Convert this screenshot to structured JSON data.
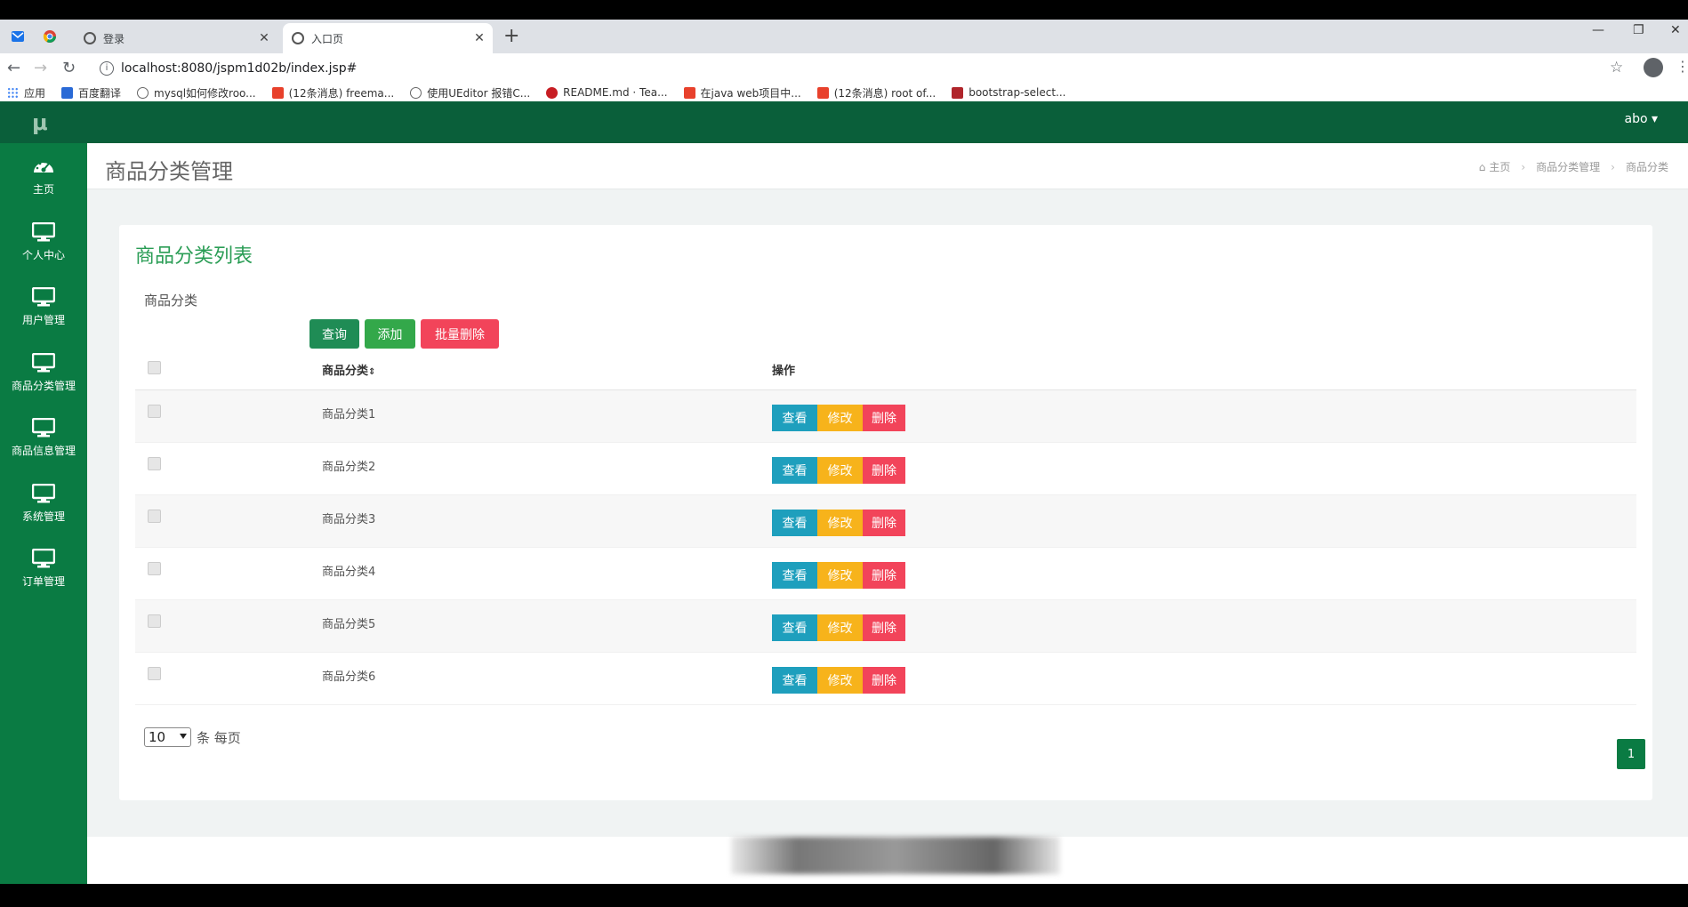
{
  "browser": {
    "tabs": [
      {
        "title": "登录"
      },
      {
        "title": "入口页"
      }
    ],
    "url": "localhost:8080/jspm1d02b/index.jsp#",
    "bookmarks": [
      {
        "label": "应用",
        "color": "#4285f4"
      },
      {
        "label": "百度翻译",
        "color": "#2a6ad6"
      },
      {
        "label": "mysql如何修改roo...",
        "color": "#666666"
      },
      {
        "label": "(12条消息) freema...",
        "color": "#e8412c"
      },
      {
        "label": "使用UEditor 报错C...",
        "color": "#666666"
      },
      {
        "label": "README.md · Tea...",
        "color": "#c71d23"
      },
      {
        "label": "在java web项目中...",
        "color": "#e8412c"
      },
      {
        "label": "(12条消息) root of...",
        "color": "#e8412c"
      },
      {
        "label": "bootstrap-select...",
        "color": "#b0252b"
      }
    ]
  },
  "app": {
    "logo": "μ",
    "user": "abo ▾",
    "sidebar": [
      {
        "label": "主页",
        "icon": "dashboard-icon"
      },
      {
        "label": "个人中心",
        "icon": "monitor-icon"
      },
      {
        "label": "用户管理",
        "icon": "monitor-icon"
      },
      {
        "label": "商品分类管理",
        "icon": "monitor-icon"
      },
      {
        "label": "商品信息管理",
        "icon": "monitor-icon"
      },
      {
        "label": "系统管理",
        "icon": "monitor-icon"
      },
      {
        "label": "订单管理",
        "icon": "monitor-icon"
      }
    ],
    "page_title": "商品分类管理",
    "breadcrumb": [
      "主页",
      "商品分类管理",
      "商品分类"
    ],
    "panel_title": "商品分类列表",
    "filter_label": "商品分类",
    "buttons": {
      "query": "查询",
      "add": "添加",
      "batch_delete": "批量删除"
    },
    "table": {
      "headers": {
        "name": "商品分类",
        "ops": "操作"
      },
      "rows": [
        "商品分类1",
        "商品分类2",
        "商品分类3",
        "商品分类4",
        "商品分类5",
        "商品分类6"
      ],
      "actions": {
        "view": "查看",
        "edit": "修改",
        "delete": "删除"
      }
    },
    "pager": {
      "page_size": "10",
      "suffix": "条 每页",
      "current_page": "1"
    }
  },
  "colors": {
    "topbar": "#0a5f3a",
    "sidebar": "#0a7b43",
    "panel_title": "#2a9d55",
    "query_button": "#1f8c55",
    "add_button": "#33a84a",
    "batch_delete_button": "#f2445a",
    "view_button": "#1e9fbd",
    "edit_button": "#f7b31b",
    "delete_button": "#f2445a"
  }
}
